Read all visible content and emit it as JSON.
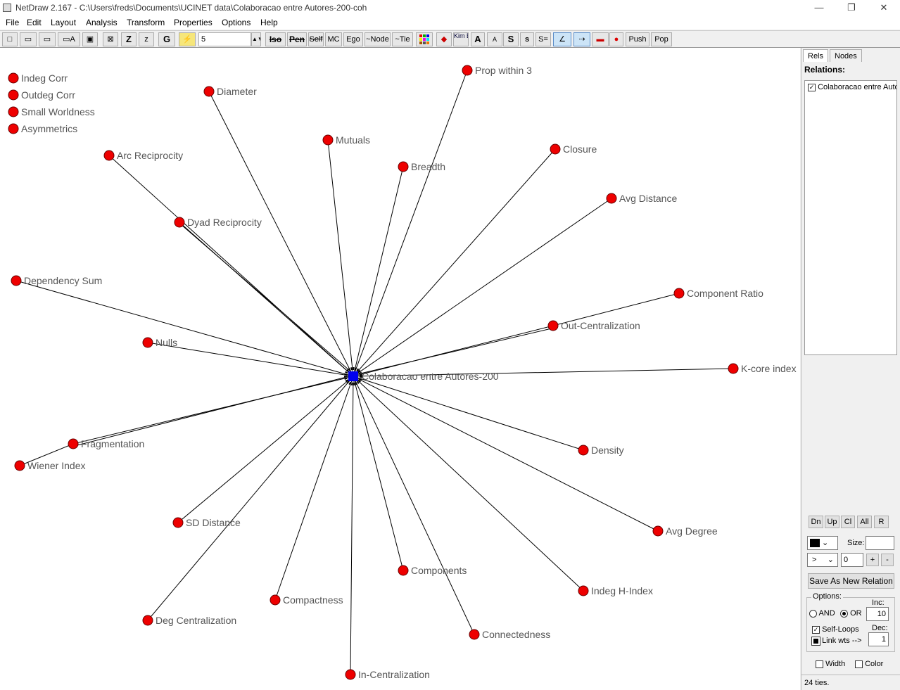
{
  "window": {
    "title": "NetDraw 2.167 - C:\\Users\\freds\\Documents\\UCINET data\\Colaboracao entre Autores-200-coh",
    "minimize": "—",
    "restore": "❐",
    "close": "✕"
  },
  "menu": [
    "File",
    "Edit",
    "Layout",
    "Analysis",
    "Transform",
    "Properties",
    "Options",
    "Help"
  ],
  "toolbar": {
    "spin_value": "5",
    "buttons": [
      "Z",
      "z",
      "G",
      "Iso",
      "Pen",
      "Self",
      "MC",
      "Ego",
      "~Node",
      "~Tie",
      "A",
      "A",
      "S",
      "s",
      "S=",
      "Push",
      "Pop"
    ],
    "kim_bill": "Kim Bill"
  },
  "network": {
    "center_label": "Colaboracao entre Autores-200",
    "node_color": "#ee0000",
    "center_color": "#0000ee",
    "nodes": [
      "Indeg Corr",
      "Outdeg Corr",
      "Small Worldness",
      "Asymmetrics",
      "Diameter",
      "Prop within 3",
      "Mutuals",
      "Breadth",
      "Closure",
      "Arc Reciprocity",
      "Avg Distance",
      "Dyad Reciprocity",
      "Dependency Sum",
      "Component Ratio",
      "Out-Centralization",
      "Nulls",
      "K-core index",
      "Fragmentation",
      "Wiener Index",
      "Density",
      "SD Distance",
      "Avg Degree",
      "Components",
      "Indeg H-Index",
      "Compactness",
      "Deg Centralization",
      "Connectedness",
      "In-Centralization"
    ]
  },
  "sidepanel": {
    "tabs": [
      "Rels",
      "Nodes"
    ],
    "relations_label": "Relations:",
    "relation_item": "Colaboracao entre Auto",
    "relation_checked": true,
    "nav_buttons": [
      "Dn",
      "Up",
      "Cl",
      "All",
      "R"
    ],
    "size_label": "Size:",
    "size_value": "",
    "op_symbol": ">",
    "threshold_value": "0",
    "plus": "+",
    "minus": "-",
    "save_relation": "Save As New Relation",
    "options_label": "Options:",
    "and_label": "AND",
    "or_label": "OR",
    "inc_label": "Inc:",
    "inc_value": "10",
    "self_loops": "Self-Loops",
    "link_wts": "Link wts -->",
    "dec_label": "Dec:",
    "dec_value": "1",
    "width_label": "Width",
    "color_label": "Color",
    "status": "24 ties."
  }
}
